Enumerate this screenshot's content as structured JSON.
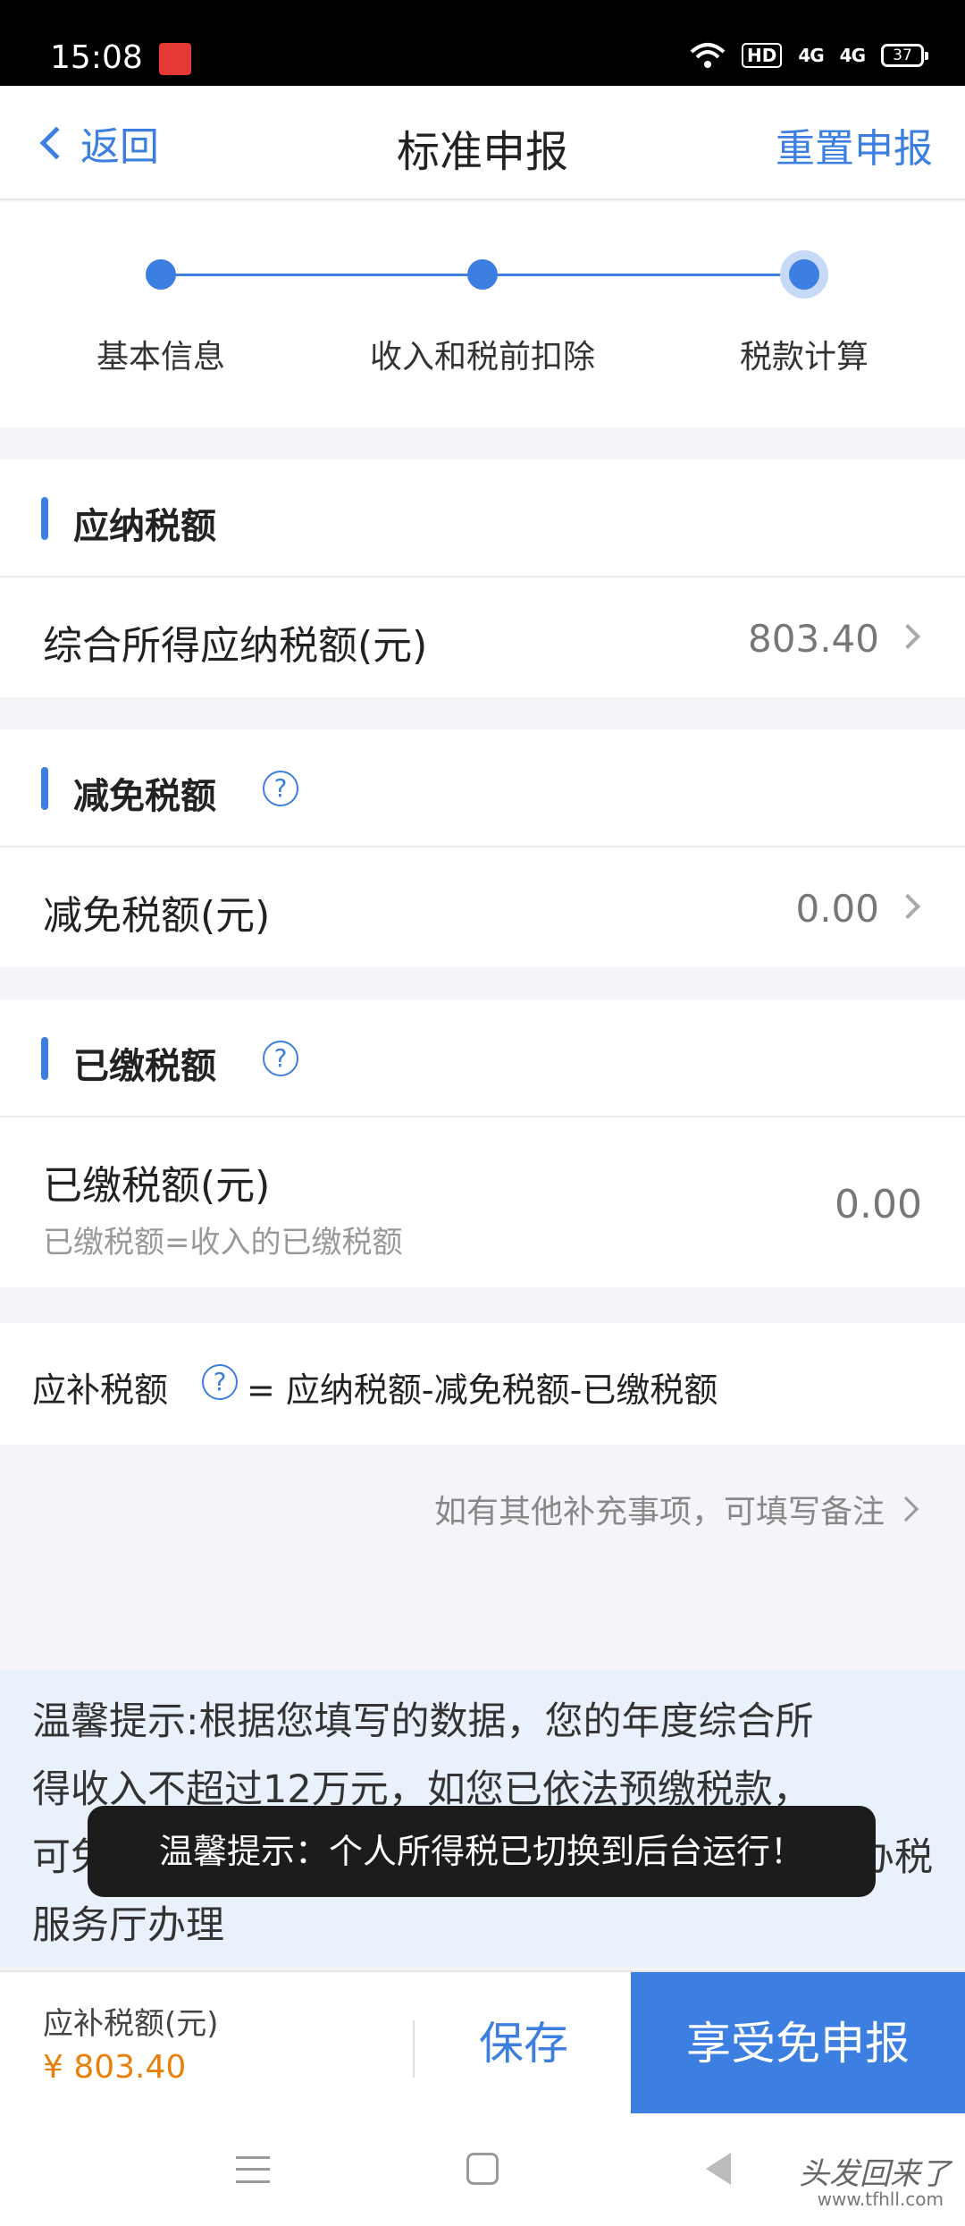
{
  "status_bar": {
    "time": "15:08",
    "hd": "HD",
    "signal_1": "4G",
    "signal_2": "4G",
    "battery": "37"
  },
  "nav": {
    "back_label": "返回",
    "title": "标准申报",
    "reset_label": "重置申报"
  },
  "steps": [
    {
      "label": "基本信息"
    },
    {
      "label": "收入和税前扣除"
    },
    {
      "label": "税款计算"
    }
  ],
  "sections": {
    "payable": {
      "title": "应纳税额",
      "row_label": "综合所得应纳税额(元)",
      "row_value": "803.40"
    },
    "reduction": {
      "title": "减免税额",
      "row_label": "减免税额(元)",
      "row_value": "0.00"
    },
    "paid": {
      "title": "已缴税额",
      "row_label": "已缴税额(元)",
      "row_sub": "已缴税额=收入的已缴税额",
      "row_value": "0.00"
    }
  },
  "formula": {
    "label": "应补税额",
    "text": "= 应纳税额-减免税额-已缴税额"
  },
  "remark_link": "如有其他补充事项，可填写备注",
  "tip": {
    "line1": "温馨提示:根据您填写的数据，您的年度综合所",
    "line2": "得收入不超过12万元，如您已依法预缴税款，",
    "line3_start": "可免",
    "line3_end": "办税",
    "line4": "服务厅办理"
  },
  "toast": "温馨提示：个人所得税已切换到后台运行！",
  "bottom": {
    "label": "应补税额(元)",
    "amount": "¥ 803.40",
    "save": "保存",
    "primary": "享受免申报"
  },
  "watermark": {
    "main": "头发回来了",
    "sub": "www.tfhll.com"
  }
}
